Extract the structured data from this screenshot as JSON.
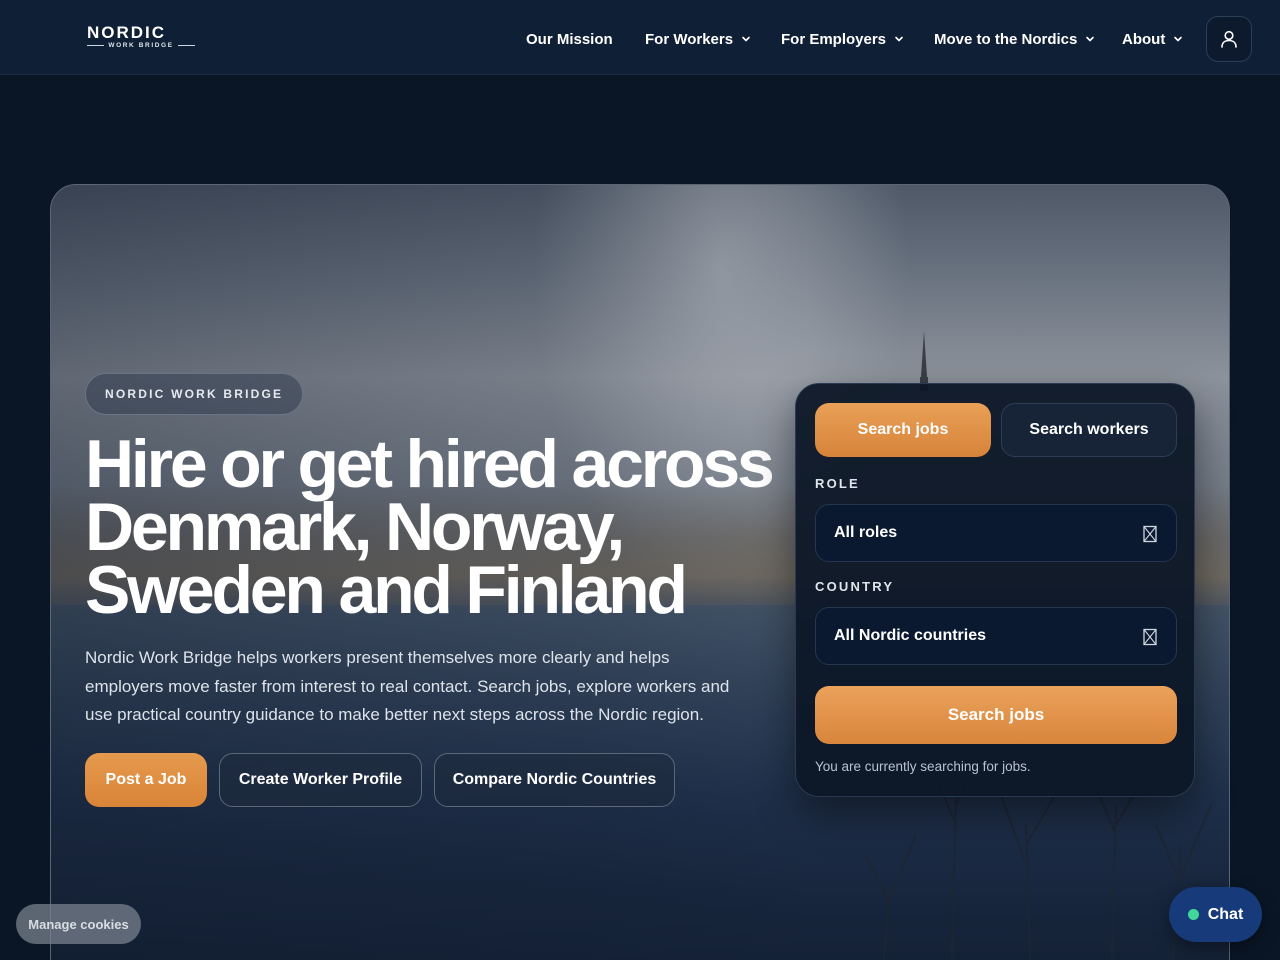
{
  "brand": {
    "name": "NORDIC",
    "tagline": "WORK BRIDGE"
  },
  "nav": {
    "items": [
      {
        "label": "Our Mission",
        "has_dropdown": false
      },
      {
        "label": "For Workers",
        "has_dropdown": true
      },
      {
        "label": "For Employers",
        "has_dropdown": true
      },
      {
        "label": "Move to the Nordics",
        "has_dropdown": true
      },
      {
        "label": "About",
        "has_dropdown": true
      }
    ],
    "account_icon": "user-icon"
  },
  "hero": {
    "eyebrow": "NORDIC WORK BRIDGE",
    "headline_lines": [
      "Hire or get hired across",
      "Denmark, Norway,",
      "Sweden and Finland"
    ],
    "description": "Nordic Work Bridge helps workers present themselves more clearly and helps employers move faster from interest to real contact. Search jobs, explore workers and use practical country guidance to make better next steps across the Nordic region.",
    "actions": [
      "Post a Job",
      "Create Worker Profile",
      "Compare Nordic Countries"
    ]
  },
  "search": {
    "tabs": [
      {
        "label": "Search jobs",
        "active": true
      },
      {
        "label": "Search workers",
        "active": false
      }
    ],
    "role_label": "ROLE",
    "role_value": "All roles",
    "country_label": "COUNTRY",
    "country_value": "All Nordic countries",
    "submit_label": "Search jobs",
    "status": "You are currently searching for jobs."
  },
  "widgets": {
    "cookies": "Manage cookies",
    "chat": "Chat",
    "chat_status_color": "#43d69a"
  },
  "colors": {
    "accent": "#e0904a",
    "background": "#0a1626",
    "chat": "#173a7a"
  }
}
